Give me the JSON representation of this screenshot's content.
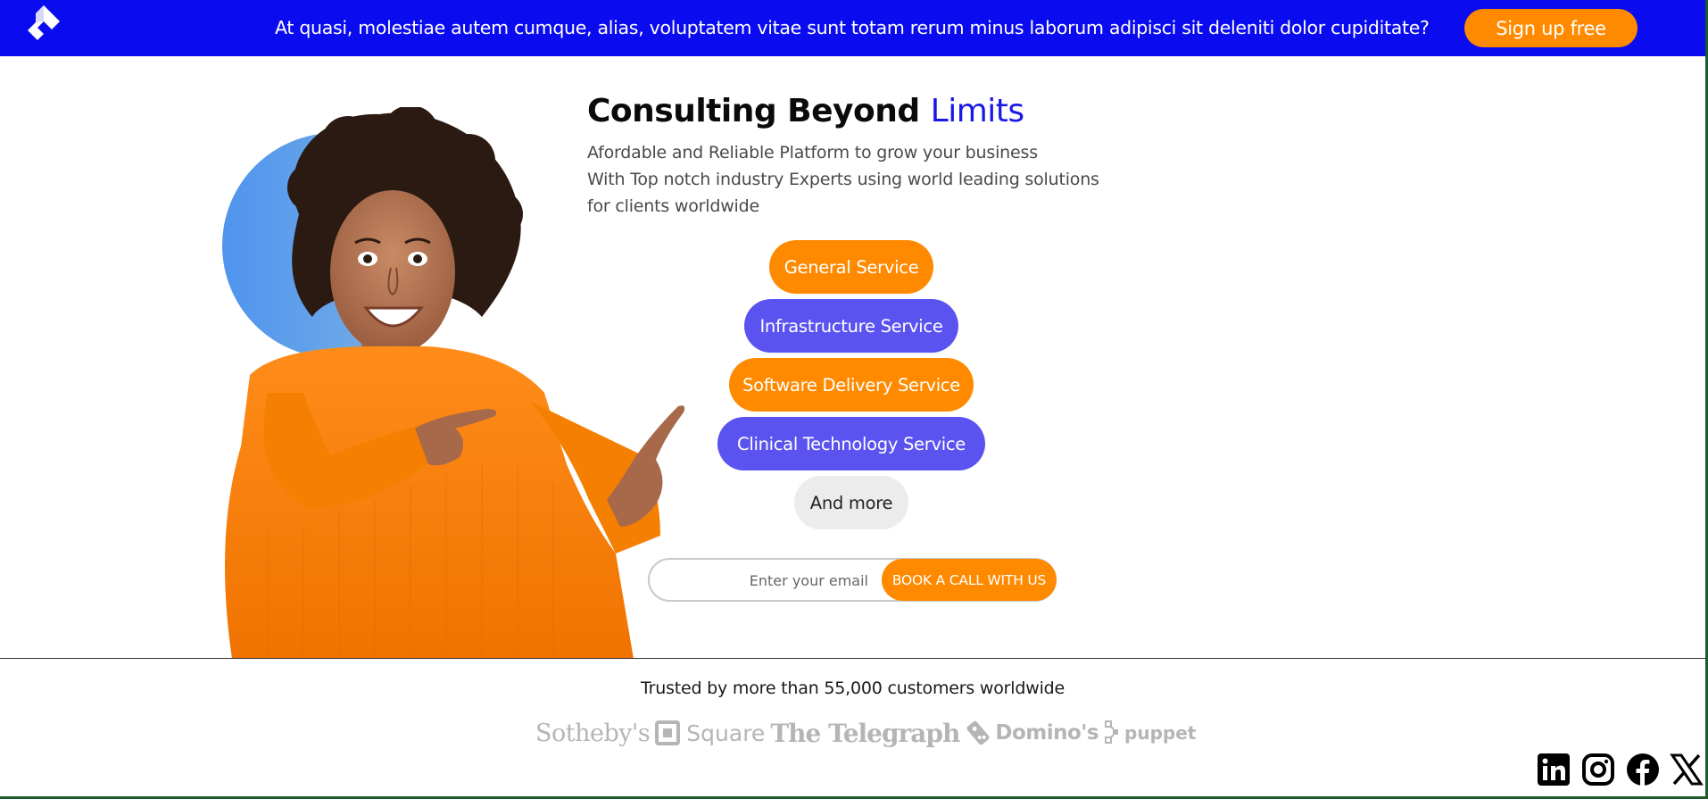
{
  "banner": {
    "message": "At quasi, molestiae autem cumque, alias, voluptatem vitae sunt totam rerum minus laborum adipisci sit deleniti dolor cupiditate?",
    "signup_label": "Sign up free",
    "logo_icon": "brand-logo-icon"
  },
  "hero": {
    "title_main": "Consulting Beyond ",
    "title_accent": "Limits",
    "subtitle_lines": [
      "Afordable and Reliable Platform to grow your business",
      "With Top notch industry Experts using world leading solutions",
      "for clients worldwide"
    ],
    "image": "woman-pointing-illustration"
  },
  "services": [
    {
      "label": "General Service",
      "color": "#ff8a00"
    },
    {
      "label": "Infrastructure Service",
      "color": "#5a53f0"
    },
    {
      "label": "Software Delivery Service",
      "color": "#ff8a00"
    },
    {
      "label": "Clinical Technology Service",
      "color": "#5a53f0"
    },
    {
      "label": "And more",
      "color": "#ececec"
    }
  ],
  "cta": {
    "email_placeholder": "Enter your email",
    "book_label": "BOOK A CALL WITH US"
  },
  "trusted": {
    "text": "Trusted by more than 55,000 customers worldwide",
    "brands": [
      "Sotheby's",
      "Square",
      "The Telegraph",
      "Domino's",
      "puppet"
    ]
  },
  "social": [
    "linkedin-icon",
    "instagram-icon",
    "facebook-icon",
    "x-icon"
  ],
  "colors": {
    "banner": "#0b0bf0",
    "accent_orange": "#ff8a00",
    "accent_purple": "#5a53f0",
    "title_accent": "#1717e8"
  }
}
